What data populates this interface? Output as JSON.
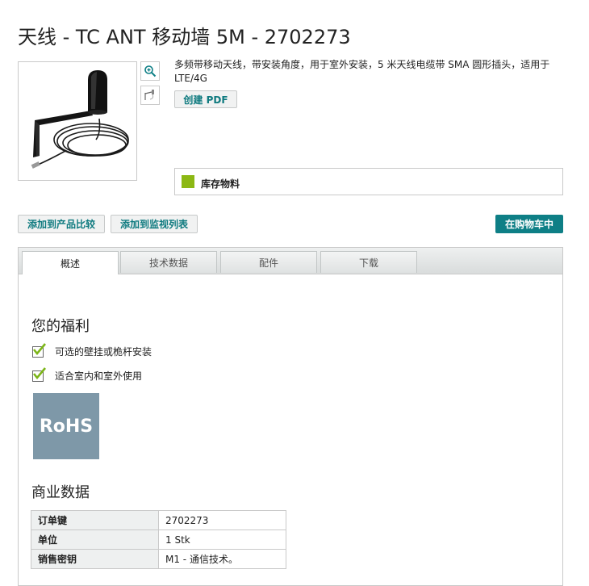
{
  "title": "天线 - TC ANT 移动墙 5M - 2702273",
  "description": "多频带移动天线，带安装角度，用于室外安装，5 米天线电缆带 SMA 圆形插头，适用于 LTE/4G",
  "buttons": {
    "create_pdf": "创建 PDF",
    "add_compare": "添加到产品比较",
    "add_watchlist": "添加到监视列表",
    "in_cart": "在购物车中"
  },
  "stock": {
    "label": "库存物料",
    "color": "#8cb814"
  },
  "tabs": [
    {
      "label": "概述",
      "active": true
    },
    {
      "label": "技术数据",
      "active": false
    },
    {
      "label": "配件",
      "active": false
    },
    {
      "label": "下载",
      "active": false
    }
  ],
  "benefits": {
    "heading": "您的福利",
    "items": [
      "可选的壁挂或桅杆安装",
      "适合室内和室外使用"
    ]
  },
  "rohs_badge": "RoHS",
  "commercial": {
    "heading": "商业数据",
    "rows": [
      {
        "key": "订单键",
        "value": "2702273"
      },
      {
        "key": "单位",
        "value": "1 Stk"
      },
      {
        "key": "销售密钥",
        "value": "M1 - 通信技术。"
      }
    ]
  },
  "icons": {
    "zoom": "zoom-in-icon",
    "thumbnail": "product-thumbnail-icon",
    "check": "checkmark-icon"
  },
  "colors": {
    "accent": "#0e7f86",
    "link": "#0e7a7f",
    "rohs": "#7e98a8"
  }
}
